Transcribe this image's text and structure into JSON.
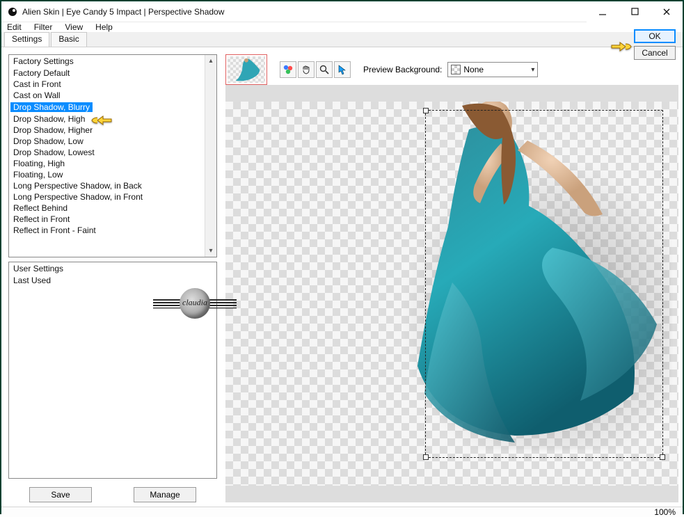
{
  "title": "Alien Skin | Eye Candy 5 Impact | Perspective Shadow",
  "menu": {
    "edit": "Edit",
    "filter": "Filter",
    "view": "View",
    "help": "Help"
  },
  "tabs": {
    "settings": "Settings",
    "basic": "Basic"
  },
  "dialog": {
    "ok": "OK",
    "cancel": "Cancel"
  },
  "factory": {
    "header": "Factory Settings",
    "items": [
      "Factory Default",
      "Cast in Front",
      "Cast on Wall",
      "Drop Shadow, Blurry",
      "Drop Shadow, High",
      "Drop Shadow, Higher",
      "Drop Shadow, Low",
      "Drop Shadow, Lowest",
      "Floating, High",
      "Floating, Low",
      "Long Perspective Shadow, in Back",
      "Long Perspective Shadow, in Front",
      "Reflect Behind",
      "Reflect in Front",
      "Reflect in Front - Faint"
    ],
    "selected_index": 3
  },
  "user": {
    "header": "User Settings",
    "items": [
      "Last Used"
    ]
  },
  "buttons": {
    "save": "Save",
    "manage": "Manage"
  },
  "preview": {
    "bg_label": "Preview Background:",
    "bg_value": "None"
  },
  "status": {
    "zoom": "100%"
  },
  "watermark": {
    "text": "claudia"
  }
}
